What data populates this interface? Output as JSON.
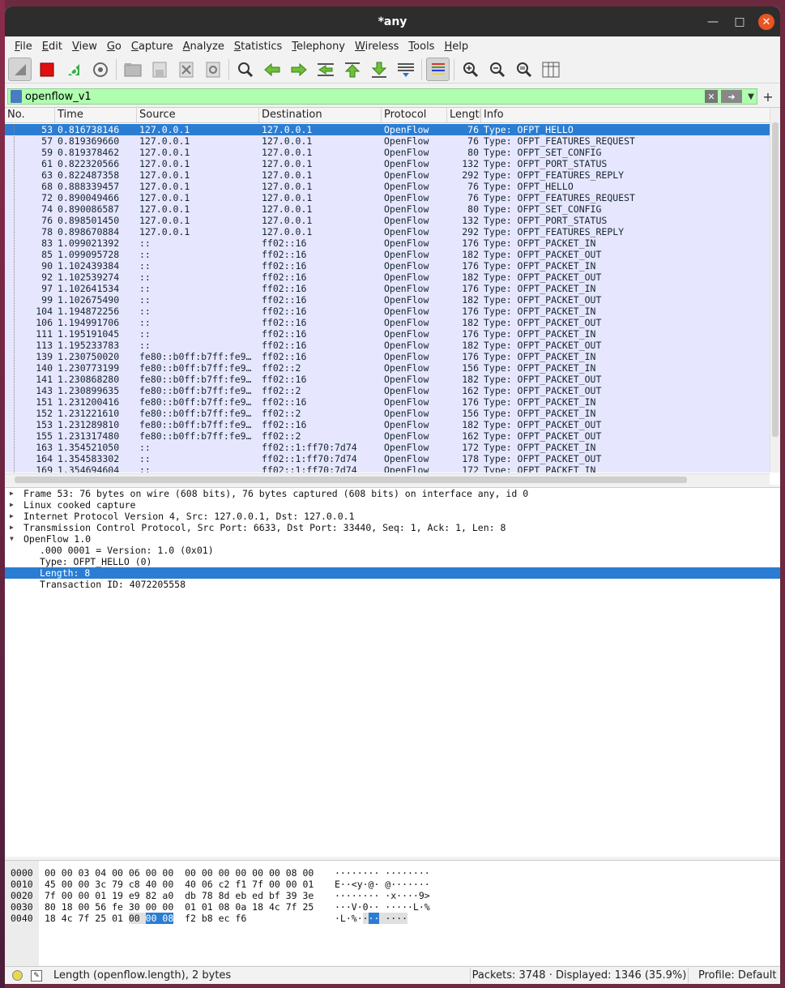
{
  "window": {
    "title": "*any"
  },
  "menu": [
    "File",
    "Edit",
    "View",
    "Go",
    "Capture",
    "Analyze",
    "Statistics",
    "Telephony",
    "Wireless",
    "Tools",
    "Help"
  ],
  "filter": {
    "value": "openflow_v1"
  },
  "columns": {
    "no": "No.",
    "time": "Time",
    "source": "Source",
    "destination": "Destination",
    "protocol": "Protocol",
    "length": "Length",
    "info": "Info"
  },
  "packets": [
    [
      "53",
      "0.816738146",
      "127.0.0.1",
      "127.0.0.1",
      "OpenFlow",
      "76",
      "Type: OFPT_HELLO"
    ],
    [
      "57",
      "0.819369660",
      "127.0.0.1",
      "127.0.0.1",
      "OpenFlow",
      "76",
      "Type: OFPT_FEATURES_REQUEST"
    ],
    [
      "59",
      "0.819378462",
      "127.0.0.1",
      "127.0.0.1",
      "OpenFlow",
      "80",
      "Type: OFPT_SET_CONFIG"
    ],
    [
      "61",
      "0.822320566",
      "127.0.0.1",
      "127.0.0.1",
      "OpenFlow",
      "132",
      "Type: OFPT_PORT_STATUS"
    ],
    [
      "63",
      "0.822487358",
      "127.0.0.1",
      "127.0.0.1",
      "OpenFlow",
      "292",
      "Type: OFPT_FEATURES_REPLY"
    ],
    [
      "68",
      "0.888339457",
      "127.0.0.1",
      "127.0.0.1",
      "OpenFlow",
      "76",
      "Type: OFPT_HELLO"
    ],
    [
      "72",
      "0.890049466",
      "127.0.0.1",
      "127.0.0.1",
      "OpenFlow",
      "76",
      "Type: OFPT_FEATURES_REQUEST"
    ],
    [
      "74",
      "0.890086587",
      "127.0.0.1",
      "127.0.0.1",
      "OpenFlow",
      "80",
      "Type: OFPT_SET_CONFIG"
    ],
    [
      "76",
      "0.898501450",
      "127.0.0.1",
      "127.0.0.1",
      "OpenFlow",
      "132",
      "Type: OFPT_PORT_STATUS"
    ],
    [
      "78",
      "0.898670884",
      "127.0.0.1",
      "127.0.0.1",
      "OpenFlow",
      "292",
      "Type: OFPT_FEATURES_REPLY"
    ],
    [
      "83",
      "1.099021392",
      "::",
      "ff02::16",
      "OpenFlow",
      "176",
      "Type: OFPT_PACKET_IN"
    ],
    [
      "85",
      "1.099095728",
      "::",
      "ff02::16",
      "OpenFlow",
      "182",
      "Type: OFPT_PACKET_OUT"
    ],
    [
      "90",
      "1.102439384",
      "::",
      "ff02::16",
      "OpenFlow",
      "176",
      "Type: OFPT_PACKET_IN"
    ],
    [
      "92",
      "1.102539274",
      "::",
      "ff02::16",
      "OpenFlow",
      "182",
      "Type: OFPT_PACKET_OUT"
    ],
    [
      "97",
      "1.102641534",
      "::",
      "ff02::16",
      "OpenFlow",
      "176",
      "Type: OFPT_PACKET_IN"
    ],
    [
      "99",
      "1.102675490",
      "::",
      "ff02::16",
      "OpenFlow",
      "182",
      "Type: OFPT_PACKET_OUT"
    ],
    [
      "104",
      "1.194872256",
      "::",
      "ff02::16",
      "OpenFlow",
      "176",
      "Type: OFPT_PACKET_IN"
    ],
    [
      "106",
      "1.194991706",
      "::",
      "ff02::16",
      "OpenFlow",
      "182",
      "Type: OFPT_PACKET_OUT"
    ],
    [
      "111",
      "1.195191045",
      "::",
      "ff02::16",
      "OpenFlow",
      "176",
      "Type: OFPT_PACKET_IN"
    ],
    [
      "113",
      "1.195233783",
      "::",
      "ff02::16",
      "OpenFlow",
      "182",
      "Type: OFPT_PACKET_OUT"
    ],
    [
      "139",
      "1.230750020",
      "fe80::b0ff:b7ff:fe9…",
      "ff02::16",
      "OpenFlow",
      "176",
      "Type: OFPT_PACKET_IN"
    ],
    [
      "140",
      "1.230773199",
      "fe80::b0ff:b7ff:fe9…",
      "ff02::2",
      "OpenFlow",
      "156",
      "Type: OFPT_PACKET_IN"
    ],
    [
      "141",
      "1.230868280",
      "fe80::b0ff:b7ff:fe9…",
      "ff02::16",
      "OpenFlow",
      "182",
      "Type: OFPT_PACKET_OUT"
    ],
    [
      "143",
      "1.230899635",
      "fe80::b0ff:b7ff:fe9…",
      "ff02::2",
      "OpenFlow",
      "162",
      "Type: OFPT_PACKET_OUT"
    ],
    [
      "151",
      "1.231200416",
      "fe80::b0ff:b7ff:fe9…",
      "ff02::16",
      "OpenFlow",
      "176",
      "Type: OFPT_PACKET_IN"
    ],
    [
      "152",
      "1.231221610",
      "fe80::b0ff:b7ff:fe9…",
      "ff02::2",
      "OpenFlow",
      "156",
      "Type: OFPT_PACKET_IN"
    ],
    [
      "153",
      "1.231289810",
      "fe80::b0ff:b7ff:fe9…",
      "ff02::16",
      "OpenFlow",
      "182",
      "Type: OFPT_PACKET_OUT"
    ],
    [
      "155",
      "1.231317480",
      "fe80::b0ff:b7ff:fe9…",
      "ff02::2",
      "OpenFlow",
      "162",
      "Type: OFPT_PACKET_OUT"
    ],
    [
      "163",
      "1.354521050",
      "::",
      "ff02::1:ff70:7d74",
      "OpenFlow",
      "172",
      "Type: OFPT_PACKET_IN"
    ],
    [
      "164",
      "1.354583302",
      "::",
      "ff02::1:ff70:7d74",
      "OpenFlow",
      "178",
      "Type: OFPT_PACKET_OUT"
    ],
    [
      "169",
      "1.354694604",
      "::",
      "ff02::1:ff70:7d74",
      "OpenFlow",
      "172",
      "Type: OFPT_PACKET_IN"
    ]
  ],
  "selected_packet": "53",
  "details": [
    {
      "text": "Frame 53: 76 bytes on wire (608 bits), 76 bytes captured (608 bits) on interface any, id 0",
      "indent": 0,
      "arrow": "collapsed"
    },
    {
      "text": "Linux cooked capture",
      "indent": 0,
      "arrow": "collapsed"
    },
    {
      "text": "Internet Protocol Version 4, Src: 127.0.0.1, Dst: 127.0.0.1",
      "indent": 0,
      "arrow": "collapsed"
    },
    {
      "text": "Transmission Control Protocol, Src Port: 6633, Dst Port: 33440, Seq: 1, Ack: 1, Len: 8",
      "indent": 0,
      "arrow": "collapsed"
    },
    {
      "text": "OpenFlow 1.0",
      "indent": 0,
      "arrow": "expanded"
    },
    {
      "text": ".000 0001 = Version: 1.0 (0x01)",
      "indent": 1,
      "arrow": "none"
    },
    {
      "text": "Type: OFPT_HELLO (0)",
      "indent": 1,
      "arrow": "none"
    },
    {
      "text": "Length: 8",
      "indent": 1,
      "arrow": "none",
      "selected": true
    },
    {
      "text": "Transaction ID: 4072205558",
      "indent": 1,
      "arrow": "none"
    }
  ],
  "bytes": [
    {
      "offset": "0000",
      "hex": "00 00 03 04 00 06 00 00  00 00 00 00 00 00 08 00",
      "ascii": "········ ········"
    },
    {
      "offset": "0010",
      "hex": "45 00 00 3c 79 c8 40 00  40 06 c2 f1 7f 00 00 01",
      "ascii": "E··<y·@· @·······"
    },
    {
      "offset": "0020",
      "hex": "7f 00 00 01 19 e9 82 a0  db 78 8d eb ed bf 39 3e",
      "ascii": "········ ·x····9>"
    },
    {
      "offset": "0030",
      "hex": "80 18 00 56 fe 30 00 00  01 01 08 0a 18 4c 7f 25",
      "ascii": "···V·0·· ·····L·%"
    }
  ],
  "bytes_last": {
    "offset": "0040",
    "hex_a": "18 4c 7f 25 01 ",
    "hex_b": "00 ",
    "hex_sel": "00 08",
    "hex_c": "  f2 b8 ec f6",
    "ascii_a": "·L·%·",
    "ascii_b": "·",
    "ascii_sel": "··",
    "ascii_c": " ····"
  },
  "status": {
    "message": "Length (openflow.length), 2 bytes",
    "packets": "Packets: 3748 · Displayed: 1346 (35.9%)",
    "profile": "Profile: Default"
  }
}
